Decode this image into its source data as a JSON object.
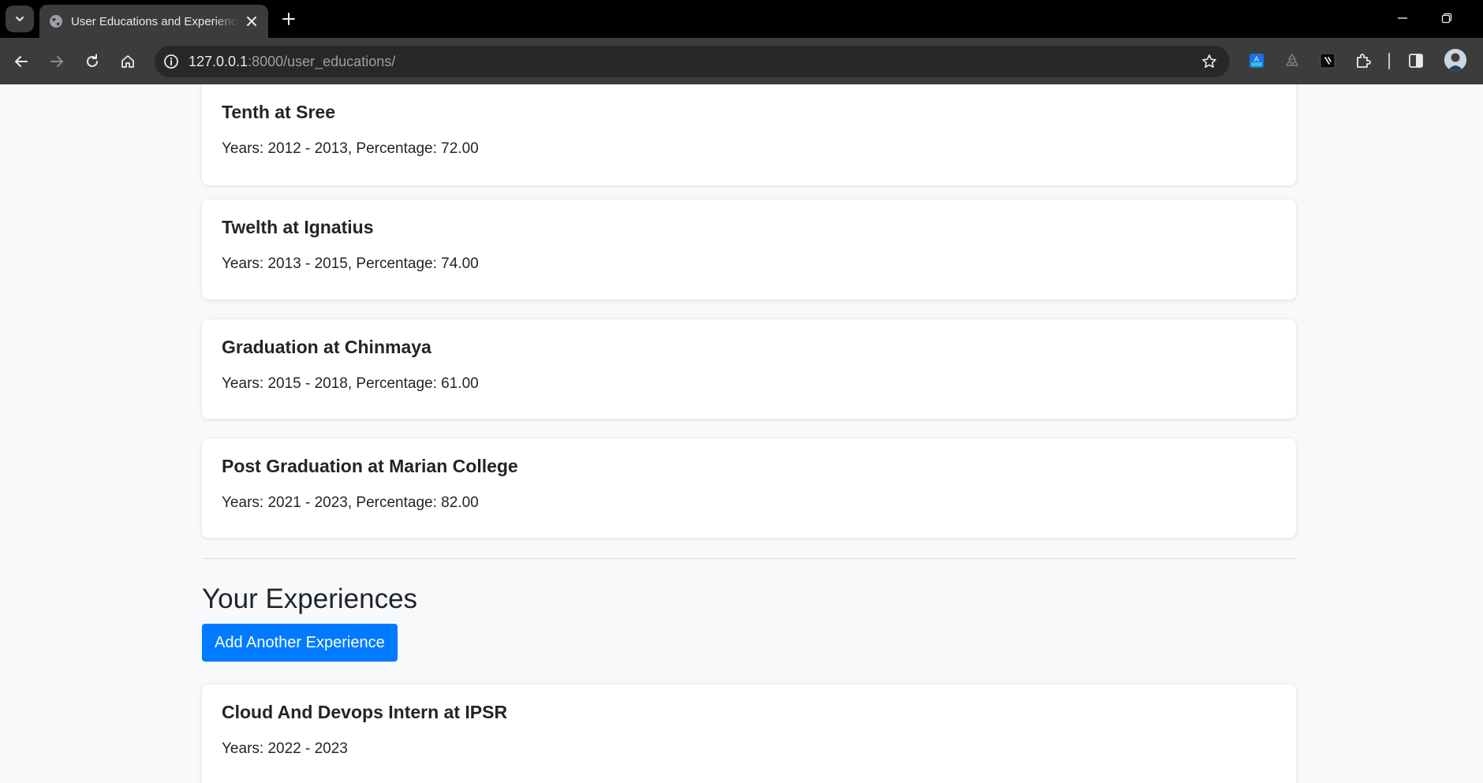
{
  "browser": {
    "tab_title": "User Educations and Experiences",
    "url_host": "127.0.0.1",
    "url_rest": ":8000/user_educations/"
  },
  "educations": [
    {
      "title": "Tenth at Sree",
      "details": "Years: 2012 - 2013, Percentage: 72.00"
    },
    {
      "title": "Twelth at Ignatius",
      "details": "Years: 2013 - 2015, Percentage: 74.00"
    },
    {
      "title": "Graduation at Chinmaya",
      "details": "Years: 2015 - 2018, Percentage: 61.00"
    },
    {
      "title": "Post Graduation at Marian College",
      "details": "Years: 2021 - 2023, Percentage: 82.00"
    }
  ],
  "experiences_section": {
    "heading": "Your Experiences",
    "add_button": "Add Another Experience"
  },
  "experiences": [
    {
      "title": "Cloud And Devops Intern at IPSR",
      "details": "Years: 2022 - 2023"
    }
  ],
  "colors": {
    "primary": "#007bff",
    "page_bg": "#f8f9fa",
    "chrome_dark": "#3c3c3c"
  }
}
